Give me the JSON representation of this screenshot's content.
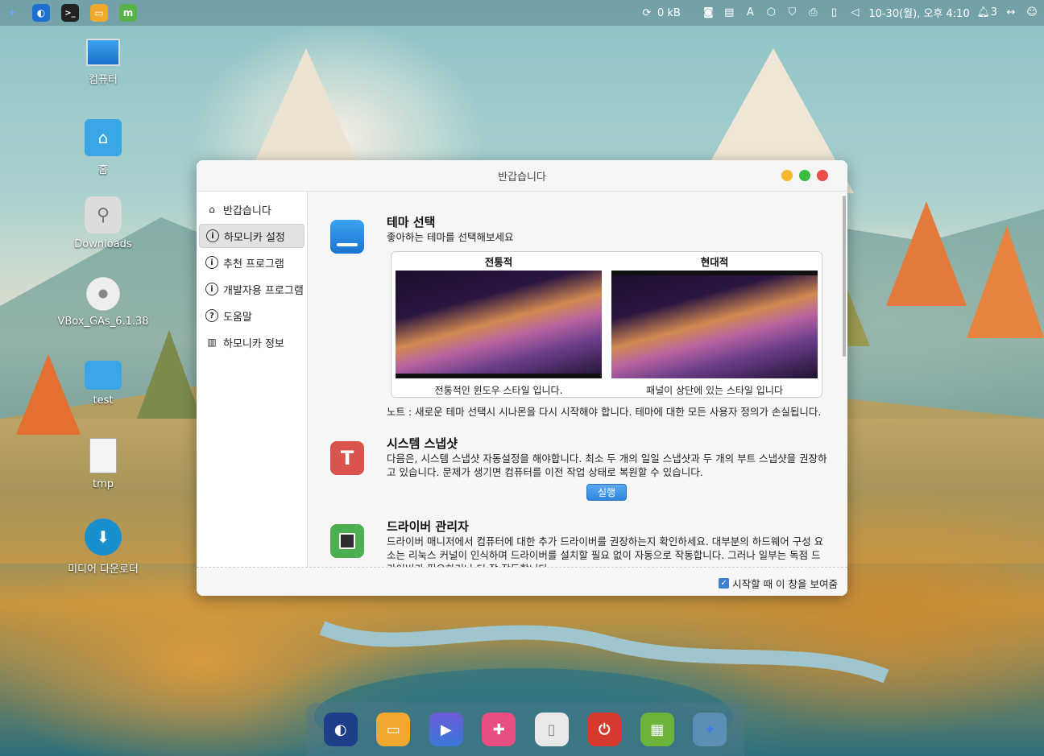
{
  "topbar": {
    "apps": [
      "app-launcher",
      "browser",
      "terminal",
      "files",
      "mint"
    ],
    "net_speed": "0 kB",
    "datetime": "10-30(월), 오후 4:10",
    "notif_count": "3"
  },
  "desktop": {
    "icons": [
      {
        "label": "컴퓨터",
        "icon": "monitor-icon"
      },
      {
        "label": "홈",
        "icon": "home-folder-icon"
      },
      {
        "label": "Downloads",
        "icon": "usb-icon"
      },
      {
        "label": "VBox_GAs_6.1.38",
        "icon": "disc-icon"
      },
      {
        "label": "test",
        "icon": "folder-icon"
      },
      {
        "label": "tmp",
        "icon": "document-icon"
      },
      {
        "label": "미디어 다운로더",
        "icon": "download-icon"
      }
    ]
  },
  "window": {
    "title": "반갑습니다",
    "sidebar": [
      {
        "label": "반갑습니다",
        "icon": "home-icon"
      },
      {
        "label": "하모니카 설정",
        "icon": "info-icon"
      },
      {
        "label": "추천 프로그램",
        "icon": "info-icon"
      },
      {
        "label": "개발자용 프로그램",
        "icon": "info-icon"
      },
      {
        "label": "도움말",
        "icon": "help-icon"
      },
      {
        "label": "하모니카 정보",
        "icon": "book-icon"
      }
    ],
    "theme": {
      "title": "테마 선택",
      "subtitle": "좋아하는 테마를 선택해보세요",
      "traditional_name": "전통적",
      "traditional_caption": "전통적인 윈도우 스타일 입니다.",
      "modern_name": "현대적",
      "modern_caption": "패널이 상단에 있는 스타일 입니다",
      "note": "노트 : 새로운 테마 선택시 시나몬을 다시 시작해야 합니다. 테마에 대한 모든 사용자 정의가 손실됩니다."
    },
    "snapshot": {
      "title": "시스템 스냅샷",
      "text": "다음은, 시스템 스냅샷 자동설정을 해야합니다. 최소 두 개의 일일 스냅샷과 두 개의 부트 스냅샷을 권장하고 있습니다. 문제가 생기면 컴퓨터를 이전 작업 상태로 복원할 수 있습니다.",
      "button": "실행"
    },
    "driver": {
      "title": "드라이버 관리자",
      "text": "드라이버 매니저에서 컴퓨터에 대한 추가 드라이버를 권장하는지 확인하세요. 대부분의 하드웨어 구성 요소는 리눅스 커널이 인식하며 드라이버를 설치할 필요 없이 자동으로 작동합니다. 그러나 일부는 독점 드라이버가 필요하거나 더 잘 작동합니다."
    },
    "footer_checkbox": "시작할 때 이 창을 보여줌"
  },
  "dock": [
    "browser",
    "files",
    "media-player",
    "software",
    "trash",
    "power",
    "store",
    "launcher"
  ]
}
